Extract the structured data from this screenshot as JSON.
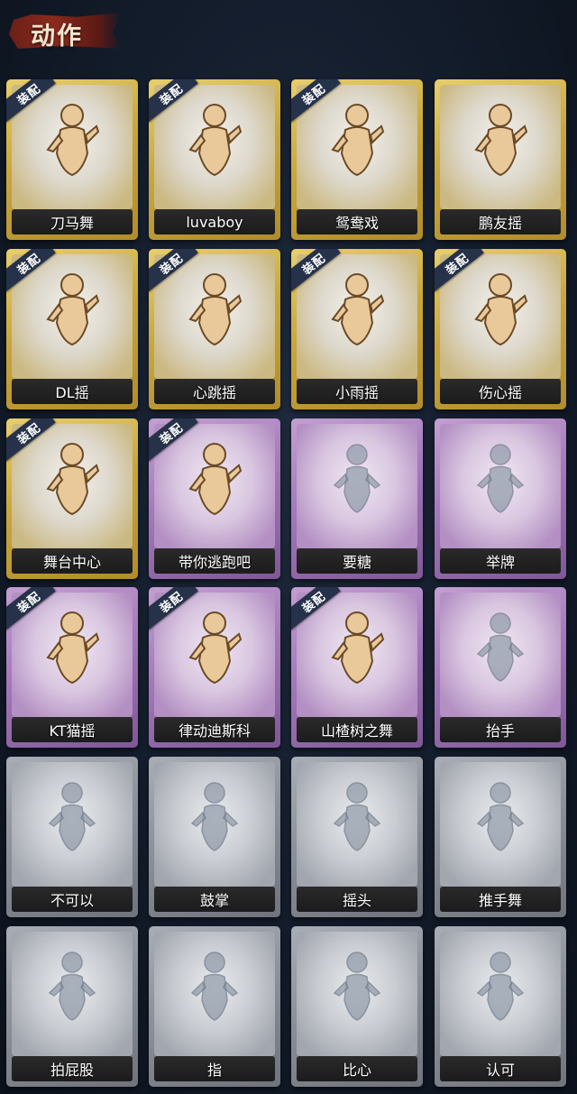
{
  "header": {
    "title": "动作"
  },
  "badge_label": "装配",
  "cards": [
    {
      "label": "刀马舞",
      "rarity": "gold",
      "equipped": true,
      "unlocked": true
    },
    {
      "label": "luvaboy",
      "rarity": "gold",
      "equipped": true,
      "unlocked": true
    },
    {
      "label": "鸳鸯戏",
      "rarity": "gold",
      "equipped": true,
      "unlocked": true
    },
    {
      "label": "鹏友摇",
      "rarity": "gold",
      "equipped": false,
      "unlocked": true
    },
    {
      "label": "DL摇",
      "rarity": "gold",
      "equipped": true,
      "unlocked": true
    },
    {
      "label": "心跳摇",
      "rarity": "gold",
      "equipped": true,
      "unlocked": true
    },
    {
      "label": "小雨摇",
      "rarity": "gold",
      "equipped": true,
      "unlocked": true
    },
    {
      "label": "伤心摇",
      "rarity": "gold",
      "equipped": true,
      "unlocked": true
    },
    {
      "label": "舞台中心",
      "rarity": "gold",
      "equipped": true,
      "unlocked": true
    },
    {
      "label": "带你逃跑吧",
      "rarity": "purple",
      "equipped": true,
      "unlocked": true
    },
    {
      "label": "要糖",
      "rarity": "purple",
      "equipped": false,
      "unlocked": false
    },
    {
      "label": "举牌",
      "rarity": "purple",
      "equipped": false,
      "unlocked": false
    },
    {
      "label": "KT猫摇",
      "rarity": "purple",
      "equipped": true,
      "unlocked": true
    },
    {
      "label": "律动迪斯科",
      "rarity": "purple",
      "equipped": true,
      "unlocked": true
    },
    {
      "label": "山楂树之舞",
      "rarity": "purple",
      "equipped": true,
      "unlocked": true
    },
    {
      "label": "抬手",
      "rarity": "purple",
      "equipped": false,
      "unlocked": false
    },
    {
      "label": "不可以",
      "rarity": "grey",
      "equipped": false,
      "unlocked": false
    },
    {
      "label": "鼓掌",
      "rarity": "grey",
      "equipped": false,
      "unlocked": false
    },
    {
      "label": "摇头",
      "rarity": "grey",
      "equipped": false,
      "unlocked": false
    },
    {
      "label": "推手舞",
      "rarity": "grey",
      "equipped": false,
      "unlocked": false
    },
    {
      "label": "拍屁股",
      "rarity": "grey",
      "equipped": false,
      "unlocked": false
    },
    {
      "label": "指",
      "rarity": "grey",
      "equipped": false,
      "unlocked": false
    },
    {
      "label": "比心",
      "rarity": "grey",
      "equipped": false,
      "unlocked": false
    },
    {
      "label": "认可",
      "rarity": "grey",
      "equipped": false,
      "unlocked": false
    }
  ],
  "colors": {
    "gold": "#c9a73d",
    "purple": "#a479bb",
    "grey": "#8c9099",
    "badge": "#26324a",
    "header_brush": "#8a2a1d"
  }
}
